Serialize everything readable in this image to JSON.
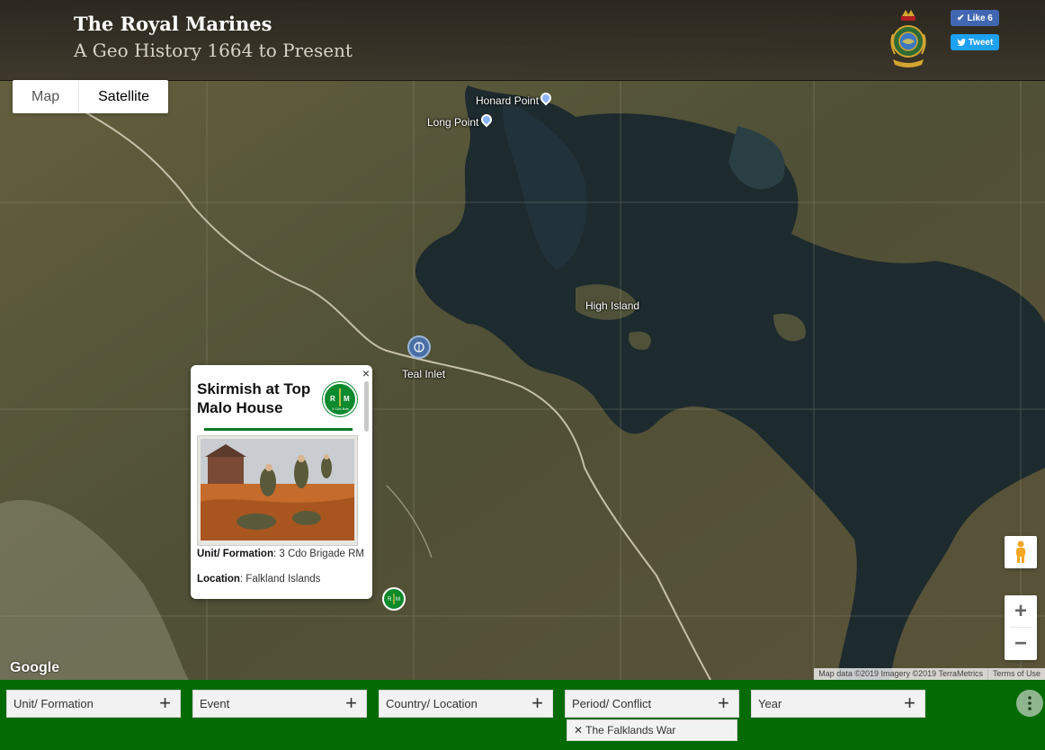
{
  "header": {
    "title": "The Royal Marines",
    "subtitle": "A Geo History 1664 to Present",
    "like_label": "Like 6",
    "tweet_label": "Tweet"
  },
  "map_type": {
    "map_label": "Map",
    "satellite_label": "Satellite",
    "selected": "Satellite"
  },
  "places": {
    "honard_point": "Honard Point",
    "long_point": "Long Point",
    "high_island": "High Island",
    "teal_inlet": "Teal Inlet"
  },
  "info_window": {
    "title": "Skirmish at Top Malo House",
    "badge_letters": "R M",
    "badge_caption": "3 Cdo Bde",
    "unit_label": "Unit/ Formation",
    "unit_value": ": 3 Cdo Brigade RM",
    "location_label": "Location",
    "location_value": ": Falkland Islands",
    "close_symbol": "×"
  },
  "map_footer": {
    "google_logo": "Google",
    "attribution": "Map data ©2019 Imagery ©2019 TerraMetrics",
    "terms": "Terms of Use"
  },
  "zoom": {
    "in_symbol": "+",
    "out_symbol": "−"
  },
  "filters": {
    "unit": "Unit/ Formation",
    "event": "Event",
    "country": "Country/ Location",
    "period": "Period/ Conflict",
    "year": "Year",
    "plus": "+",
    "active_chip": "✕ The Falklands War"
  },
  "colors": {
    "filter_bar": "#046b04",
    "marker_green": "#0c8a2e",
    "like_blue": "#4267b2",
    "tweet_blue": "#1da1f2"
  }
}
